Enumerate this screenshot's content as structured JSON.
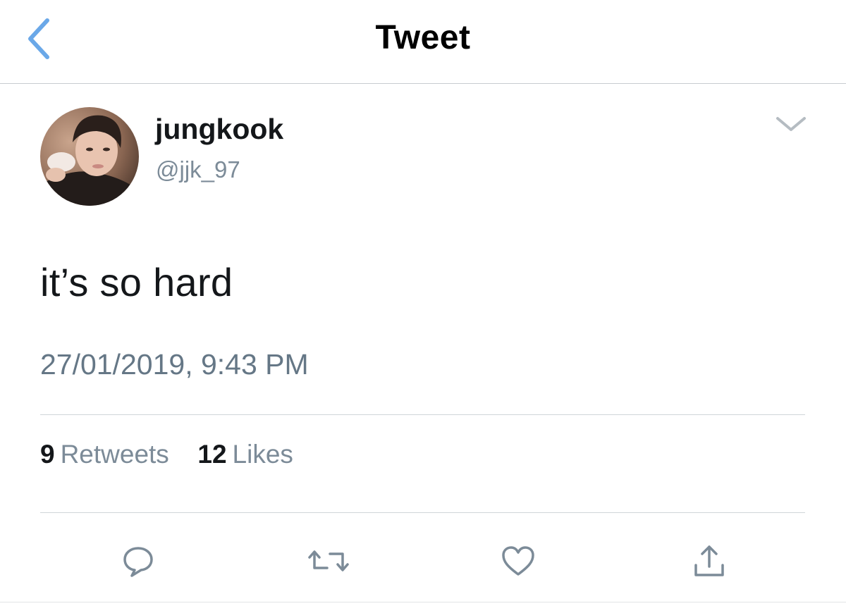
{
  "navbar": {
    "title": "Tweet",
    "back_icon": "chevron-left-icon",
    "accent_color": "#6aa8e8"
  },
  "tweet": {
    "author": {
      "display_name": "jungkook",
      "handle": "@jjk_97"
    },
    "text": "it’s so hard",
    "timestamp": "27/01/2019, 9:43 PM",
    "stats": {
      "retweets_count": "9",
      "retweets_label": "Retweets",
      "likes_count": "12",
      "likes_label": "Likes"
    },
    "actions": [
      {
        "name": "reply",
        "icon": "reply-icon"
      },
      {
        "name": "retweet",
        "icon": "retweet-icon"
      },
      {
        "name": "like",
        "icon": "heart-icon"
      },
      {
        "name": "share",
        "icon": "share-icon"
      }
    ]
  }
}
